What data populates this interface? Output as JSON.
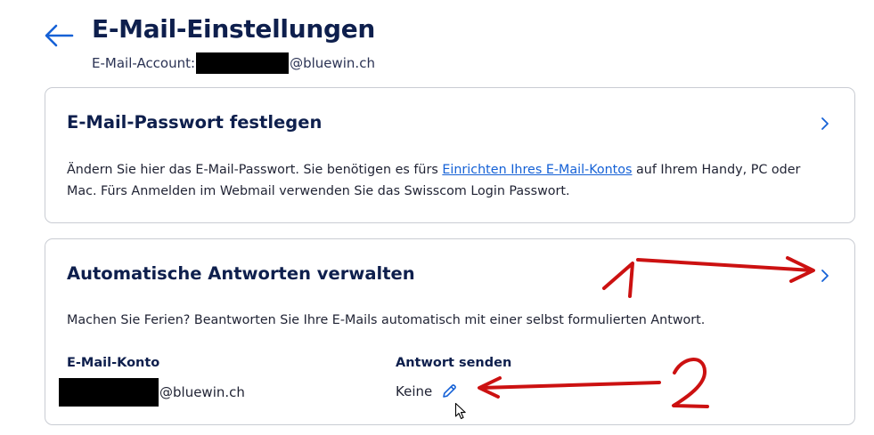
{
  "header": {
    "title": "E-Mail-Einstellungen",
    "account_prefix": "E-Mail-Account:",
    "account_domain": "@bluewin.ch"
  },
  "cards": {
    "password": {
      "title": "E-Mail-Passwort festlegen",
      "desc_before": "Ändern Sie hier das E-Mail-Passwort. Sie benötigen es fürs ",
      "desc_link": "Einrichten Ihres E-Mail-Kontos",
      "desc_after": " auf Ihrem Handy, PC oder Mac. Fürs Anmelden im Webmail verwenden Sie das Swisscom Login Passwort."
    },
    "autoreply": {
      "title": "Automatische Antworten verwalten",
      "desc": "Machen Sie Ferien? Beantworten Sie Ihre E-Mails automatisch mit einer selbst formulierten Antwort.",
      "col_account_label": "E-Mail-Konto",
      "col_account_domain": "@bluewin.ch",
      "col_reply_label": "Antwort senden",
      "col_reply_value": "Keine"
    }
  },
  "annotations": {
    "marker_1": "1",
    "marker_2": "2",
    "color": "#cc1111"
  },
  "colors": {
    "accent": "#1561d6",
    "title": "#0e1f4d",
    "border": "#c9ccd3"
  },
  "icons": [
    "back-arrow-icon",
    "chevron-right-icon",
    "pencil-icon",
    "mouse-cursor-icon"
  ]
}
